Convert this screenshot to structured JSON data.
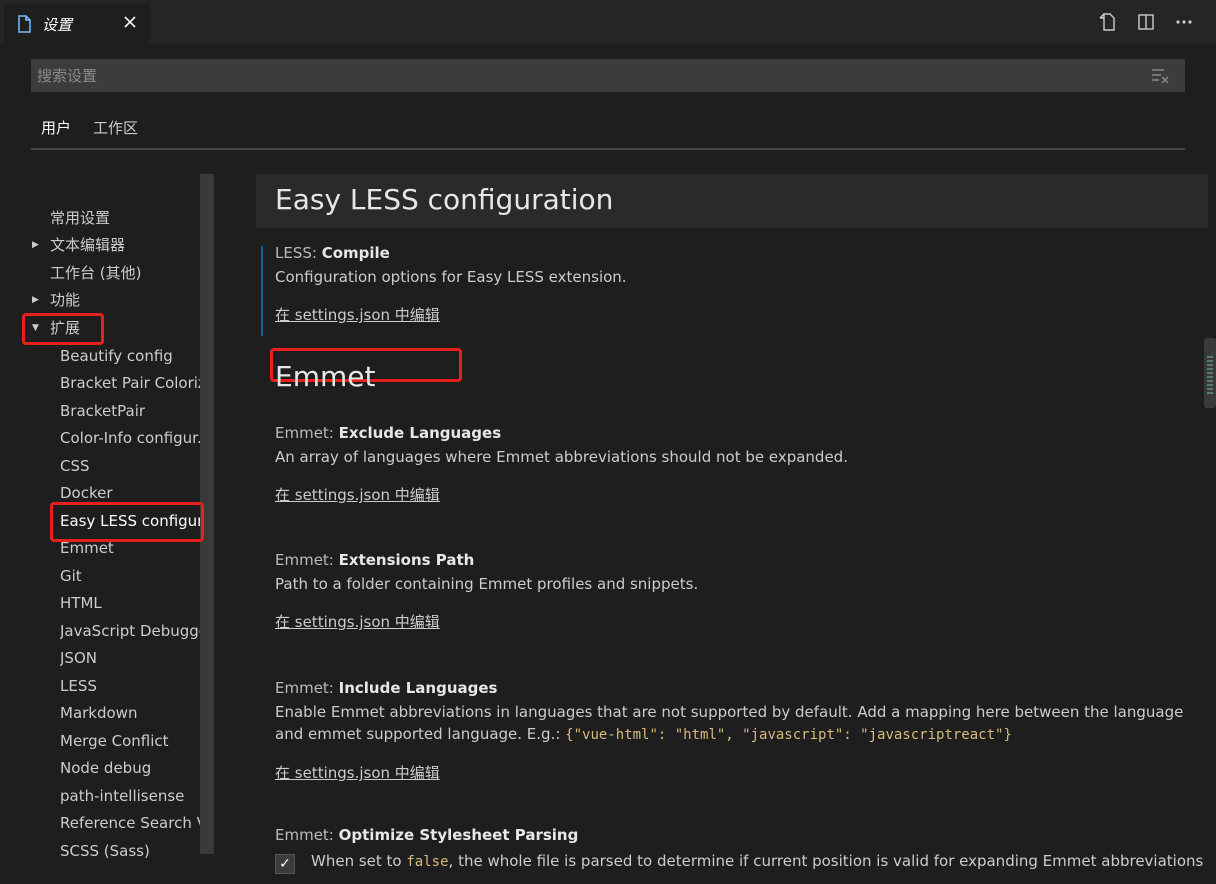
{
  "tab": {
    "title": "设置"
  },
  "search": {
    "placeholder": "搜索设置"
  },
  "scopes": {
    "user": "用户",
    "workspace": "工作区"
  },
  "toc": {
    "items": [
      {
        "label": "常用设置"
      },
      {
        "label": "文本编辑器"
      },
      {
        "label": "工作台 (其他)"
      },
      {
        "label": "功能"
      },
      {
        "label": "扩展"
      },
      {
        "label": "Beautify config"
      },
      {
        "label": "Bracket Pair Coloriz..."
      },
      {
        "label": "BracketPair"
      },
      {
        "label": "Color-Info configur..."
      },
      {
        "label": "CSS"
      },
      {
        "label": "Docker"
      },
      {
        "label": "Easy LESS configur..."
      },
      {
        "label": "Emmet"
      },
      {
        "label": "Git"
      },
      {
        "label": "HTML"
      },
      {
        "label": "JavaScript Debugger"
      },
      {
        "label": "JSON"
      },
      {
        "label": "LESS"
      },
      {
        "label": "Markdown"
      },
      {
        "label": "Merge Conflict"
      },
      {
        "label": "Node debug"
      },
      {
        "label": "path-intellisense"
      },
      {
        "label": "Reference Search V..."
      },
      {
        "label": "SCSS (Sass)"
      }
    ]
  },
  "content": {
    "group_title": "Easy LESS configuration",
    "less_compile": {
      "category": "LESS: ",
      "name": "Compile",
      "description": "Configuration options for Easy LESS extension.",
      "link": "在 settings.json 中编辑"
    },
    "emmet_title": "Emmet",
    "exclude_languages": {
      "category": "Emmet: ",
      "name": "Exclude Languages",
      "description": "An array of languages where Emmet abbreviations should not be expanded.",
      "link": "在 settings.json 中编辑"
    },
    "extensions_path": {
      "category": "Emmet: ",
      "name": "Extensions Path",
      "description": "Path to a folder containing Emmet profiles and snippets.",
      "link": "在 settings.json 中编辑"
    },
    "include_languages": {
      "category": "Emmet: ",
      "name": "Include Languages",
      "description_1": "Enable Emmet abbreviations in languages that are not supported by default. Add a mapping here between the language and emmet supported language. E.g.: ",
      "code": "{\"vue-html\": \"html\", \"javascript\": \"javascriptreact\"}",
      "link": "在 settings.json 中编辑"
    },
    "optimize_stylesheet": {
      "category": "Emmet: ",
      "name": "Optimize Stylesheet Parsing",
      "description_1": "When set to ",
      "code": "false",
      "description_2": ", the whole file is parsed to determine if current position is valid for expanding Emmet abbreviations",
      "checked": true
    }
  },
  "colors": {
    "highlight_box": "#e8201c",
    "accent": "#0e639c"
  },
  "icons": {
    "tab": "file-icon",
    "close": "close-icon",
    "open_json": "open-settings-json-icon",
    "split": "split-editor-icon",
    "more": "more-actions-icon",
    "clear": "clear-filter-icon"
  }
}
